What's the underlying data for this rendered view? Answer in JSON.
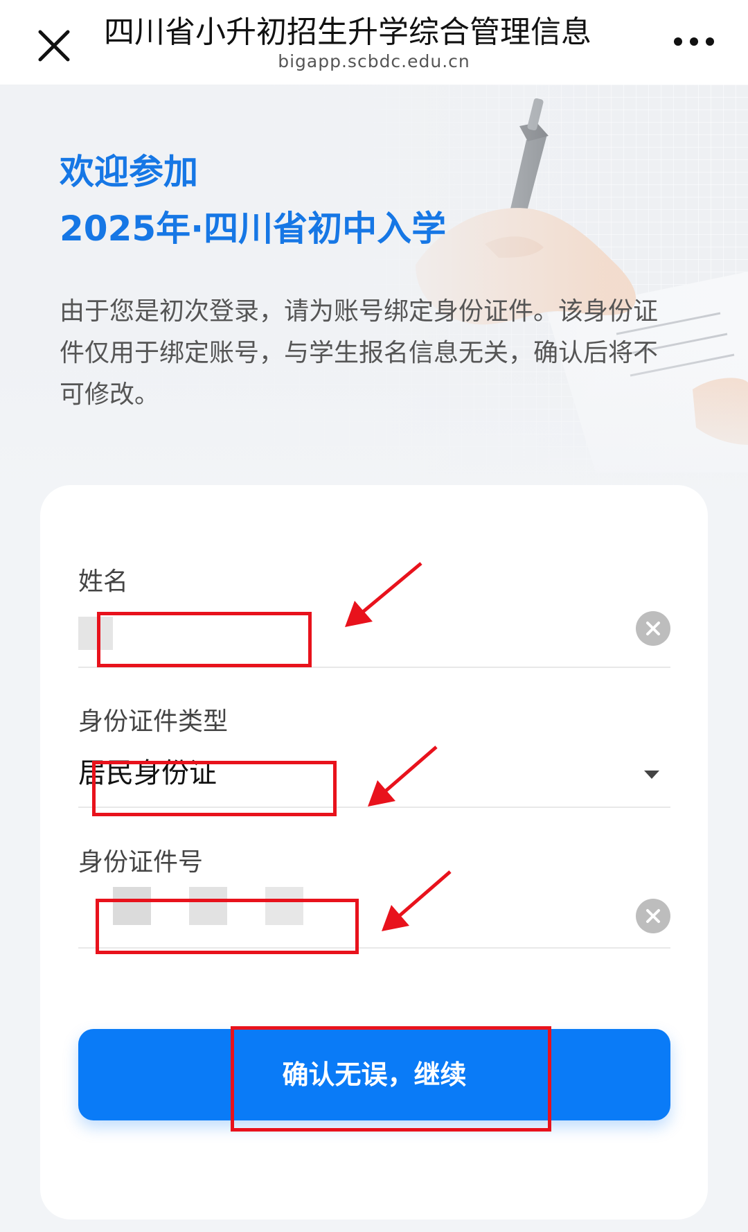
{
  "header": {
    "title": "四川省小升初招生升学综合管理信息",
    "url": "bigapp.scbdc.edu.cn",
    "close_icon": "close-icon",
    "more_icon": "more-icon"
  },
  "hero": {
    "welcome": "欢迎参加",
    "event": "2025年·四川省初中入学",
    "description": "由于您是初次登录，请为账号绑定身份证件。该身份证件仅用于绑定账号，与学生报名信息无关，确认后将不可修改。"
  },
  "form": {
    "name": {
      "label": "姓名",
      "value": ""
    },
    "id_type": {
      "label": "身份证件类型",
      "value": "居民身份证"
    },
    "id_number": {
      "label": "身份证件号",
      "value": ""
    },
    "confirm_label": "确认无误，继续"
  },
  "colors": {
    "accent": "#1677e5",
    "button": "#0a7bf7",
    "annotation": "#e8121c"
  }
}
